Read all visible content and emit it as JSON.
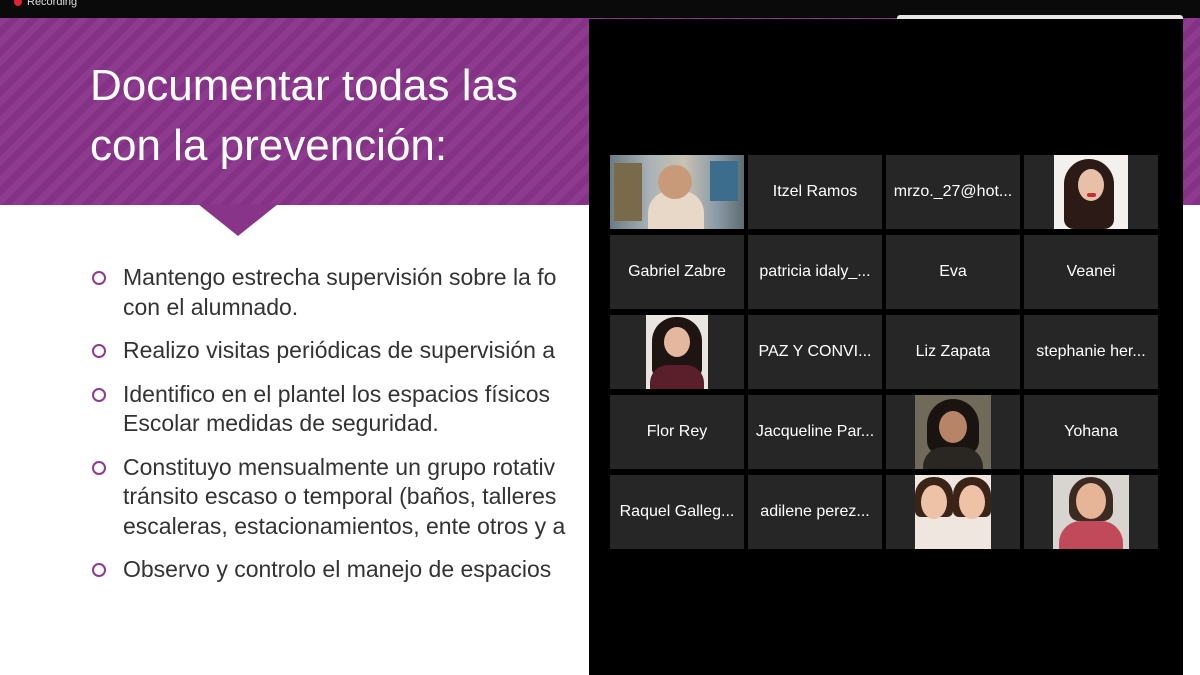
{
  "recording": {
    "label": "Recording",
    "dot_color": "#e0242b"
  },
  "slide": {
    "title_lines": [
      "Documentar todas las",
      "con la prevención:"
    ],
    "banner_color": "#8e3a8f",
    "bullets": [
      [
        "Mantengo estrecha supervisión sobre la fo",
        "con el alumnado."
      ],
      [
        "Realizo visitas periódicas de supervisión a"
      ],
      [
        "Identifico en el plantel los espacios físicos",
        "Escolar medidas de seguridad."
      ],
      [
        "Constituyo mensualmente un grupo rotativ",
        "tránsito escaso o temporal (baños, talleres",
        "escaleras, estacionamientos, ente otros y a"
      ],
      [
        "Observo y controlo el manejo de espacios"
      ]
    ]
  },
  "participants": [
    {
      "name": "",
      "video": "host",
      "active": true
    },
    {
      "name": "Itzel Ramos"
    },
    {
      "name": "mrzo._27@hot..."
    },
    {
      "name": "",
      "video": "photo-woman-dark-hair"
    },
    {
      "name": "Gabriel Zabre"
    },
    {
      "name": "patricia idaly_..."
    },
    {
      "name": "Eva"
    },
    {
      "name": "Veanei"
    },
    {
      "name": "",
      "video": "photo-woman-red-top"
    },
    {
      "name": "PAZ Y CONVI..."
    },
    {
      "name": "Liz Zapata"
    },
    {
      "name": "stephanie her..."
    },
    {
      "name": "Flor Rey"
    },
    {
      "name": "Jacqueline Par..."
    },
    {
      "name": "",
      "video": "photo-woman-short-hair"
    },
    {
      "name": "Yohana"
    },
    {
      "name": "Raquel Galleg..."
    },
    {
      "name": "adilene perez..."
    },
    {
      "name": "",
      "video": "photo-two-faces"
    },
    {
      "name": "",
      "video": "photo-woman-smiling"
    }
  ]
}
